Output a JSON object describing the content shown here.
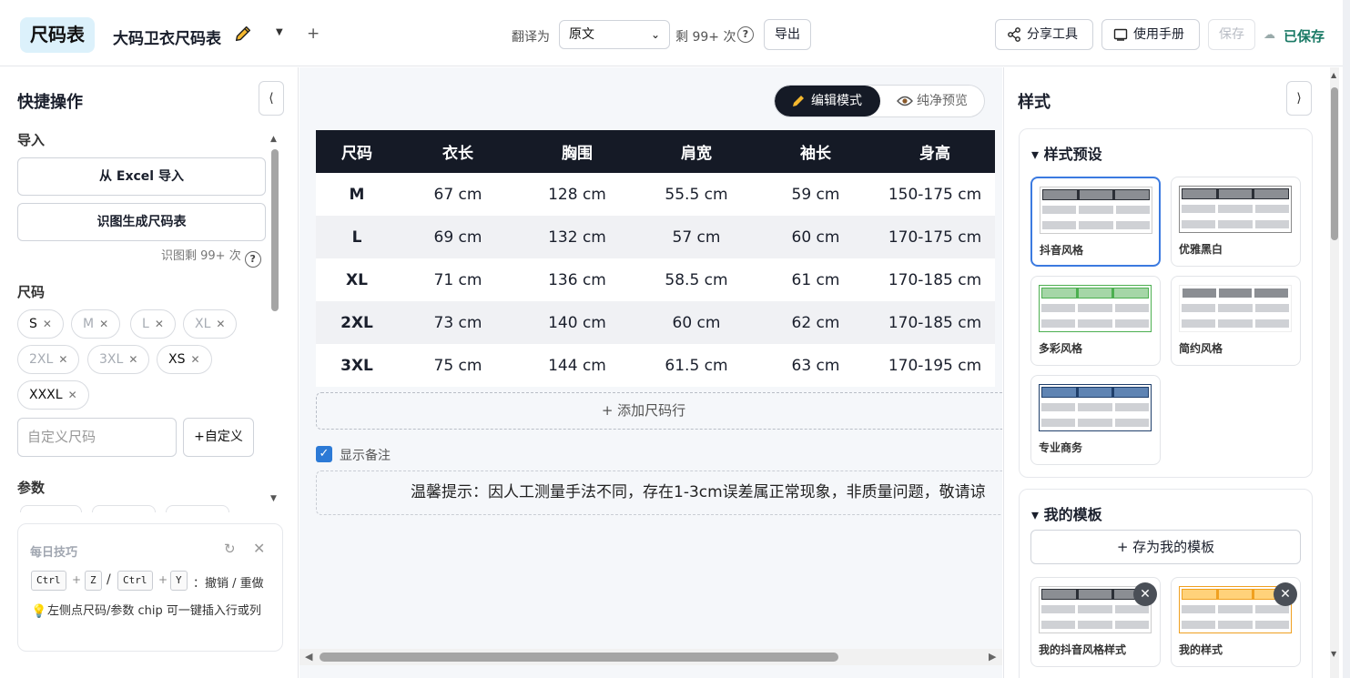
{
  "app": {
    "logo": "尺码表",
    "doc_title": "大码卫衣尺码表"
  },
  "topbar": {
    "translate_label": "翻译为",
    "translate_value": "原文",
    "remaining": "剩 99+ 次",
    "export_label": "导出",
    "share_label": "分享工具",
    "manual_label": "使用手册",
    "save_label": "保存",
    "saved_status": "已保存"
  },
  "left": {
    "title": "快捷操作",
    "import_section": "导入",
    "import_excel": "从 Excel 导入",
    "ocr_generate": "识图生成尺码表",
    "ocr_remaining": "识图剩 99+ 次",
    "sizes_section": "尺码",
    "sizes": [
      {
        "label": "S",
        "active": true
      },
      {
        "label": "M",
        "active": false
      },
      {
        "label": "L",
        "active": false
      },
      {
        "label": "XL",
        "active": false
      },
      {
        "label": "2XL",
        "active": false
      },
      {
        "label": "3XL",
        "active": false
      },
      {
        "label": "XS",
        "active": true
      },
      {
        "label": "XXXL",
        "active": true
      }
    ],
    "custom_placeholder": "自定义尺码",
    "custom_button": "+自定义",
    "params_section": "参数"
  },
  "tip": {
    "title": "每日技巧",
    "keys": [
      "Ctrl",
      "Z",
      "Ctrl",
      "Y"
    ],
    "shortcut_desc": "撤销 / 重做",
    "hint": "左侧点尺码/参数 chip 可一键插入行或列"
  },
  "editor": {
    "edit_mode": "编辑模式",
    "preview_mode": "纯净预览",
    "columns": [
      "尺码",
      "衣长",
      "胸围",
      "肩宽",
      "袖长",
      "身高"
    ],
    "rows": [
      [
        "M",
        "67 cm",
        "128 cm",
        "55.5 cm",
        "59 cm",
        "150-175 cm"
      ],
      [
        "L",
        "69 cm",
        "132 cm",
        "57 cm",
        "60 cm",
        "170-175 cm"
      ],
      [
        "XL",
        "71 cm",
        "136 cm",
        "58.5 cm",
        "61 cm",
        "170-185 cm"
      ],
      [
        "2XL",
        "73 cm",
        "140 cm",
        "60 cm",
        "62 cm",
        "170-185 cm"
      ],
      [
        "3XL",
        "75 cm",
        "144 cm",
        "61.5 cm",
        "63 cm",
        "170-195 cm"
      ]
    ],
    "add_row": "+  添加尺码行",
    "show_note_label": "显示备注",
    "show_note_checked": true,
    "note_text": "温馨提示：因人工测量手法不同，存在1-3cm误差属正常现象，非质量问题，敬请谅"
  },
  "right": {
    "title": "样式",
    "presets_title": "▾ 样式预设",
    "presets": [
      {
        "label": "抖音风格",
        "header": "#2b2f36",
        "selected": true
      },
      {
        "label": "优雅黑白",
        "header": "#2b2f36",
        "selected": false
      },
      {
        "label": "多彩风格",
        "header": "#4caf50",
        "selected": false
      },
      {
        "label": "简约风格",
        "header": "#ffffff",
        "selected": false
      },
      {
        "label": "专业商务",
        "header": "#1f3f6b",
        "selected": false
      }
    ],
    "templates_title": "▾ 我的模板",
    "save_template": "+  存为我的模板",
    "templates": [
      {
        "label": "我的抖音风格样式",
        "header": "#2b2f36"
      },
      {
        "label": "我的样式",
        "header": "#f0a020"
      }
    ]
  },
  "colors": {
    "accent": "#3b7ae0",
    "dark": "#151a26",
    "saved": "#1b7a66",
    "logo_bg": "#dcf1fb"
  }
}
